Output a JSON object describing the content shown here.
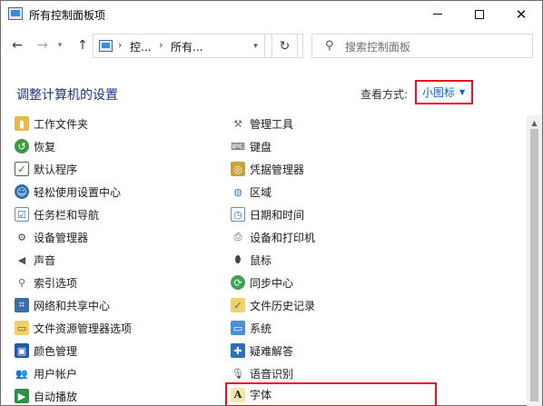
{
  "window": {
    "title": "所有控制面板项"
  },
  "address": {
    "crumbs": [
      "控...",
      "所有..."
    ],
    "search_placeholder": "搜索控制面板"
  },
  "header": {
    "title": "调整计算机的设置",
    "view_label": "查看方式:",
    "view_value": "小图标"
  },
  "left_items": [
    {
      "label": "工作文件夹",
      "icon": "work-folders-icon"
    },
    {
      "label": "恢复",
      "icon": "recovery-icon"
    },
    {
      "label": "默认程序",
      "icon": "default-programs-icon"
    },
    {
      "label": "轻松使用设置中心",
      "icon": "ease-of-access-icon"
    },
    {
      "label": "任务栏和导航",
      "icon": "taskbar-icon"
    },
    {
      "label": "设备管理器",
      "icon": "device-manager-icon"
    },
    {
      "label": "声音",
      "icon": "sound-icon"
    },
    {
      "label": "索引选项",
      "icon": "indexing-icon"
    },
    {
      "label": "网络和共享中心",
      "icon": "network-icon"
    },
    {
      "label": "文件资源管理器选项",
      "icon": "explorer-options-icon"
    },
    {
      "label": "颜色管理",
      "icon": "color-management-icon"
    },
    {
      "label": "用户帐户",
      "icon": "user-accounts-icon"
    },
    {
      "label": "自动播放",
      "icon": "autoplay-icon"
    }
  ],
  "right_items": [
    {
      "label": "管理工具",
      "icon": "admin-tools-icon"
    },
    {
      "label": "键盘",
      "icon": "keyboard-icon"
    },
    {
      "label": "凭据管理器",
      "icon": "credential-manager-icon"
    },
    {
      "label": "区域",
      "icon": "region-icon"
    },
    {
      "label": "日期和时间",
      "icon": "date-time-icon"
    },
    {
      "label": "设备和打印机",
      "icon": "devices-printers-icon"
    },
    {
      "label": "鼠标",
      "icon": "mouse-icon"
    },
    {
      "label": "同步中心",
      "icon": "sync-center-icon"
    },
    {
      "label": "文件历史记录",
      "icon": "file-history-icon"
    },
    {
      "label": "系统",
      "icon": "system-icon"
    },
    {
      "label": "疑难解答",
      "icon": "troubleshooting-icon"
    },
    {
      "label": "语音识别",
      "icon": "speech-recognition-icon"
    },
    {
      "label": "字体",
      "icon": "fonts-icon"
    }
  ],
  "highlight_color": "#e81123",
  "link_color": "#0066cc",
  "title_color": "#1e3287"
}
